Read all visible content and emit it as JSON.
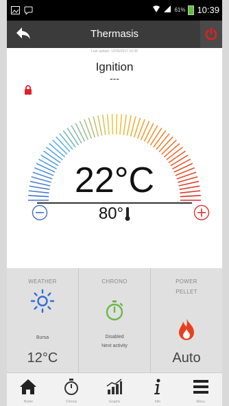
{
  "status_bar": {
    "time": "10:39",
    "battery_percent": "61%",
    "icons": [
      "gallery-icon",
      "chat-icon",
      "wifi-icon",
      "signal-icon",
      "battery-icon"
    ]
  },
  "header": {
    "title": "Thermasis",
    "back_icon": "back-arrow-icon",
    "power_icon": "power-icon",
    "power_color": "#e02020"
  },
  "last_update": "Last update: 12/05/2017 10:39",
  "main": {
    "state_label": "Ignition",
    "state_sub": "---",
    "lock_color": "#e0202a",
    "room_temperature": "22°C",
    "water_temperature": "80°",
    "minus_color": "#3a6fc2",
    "plus_color": "#e03030"
  },
  "cards": {
    "weather": {
      "title": "WEATHER",
      "city": "Bursa",
      "temperature": "12°C",
      "icon": "sun-icon",
      "icon_color": "#2f6bd6"
    },
    "chrono": {
      "title": "CHRONO",
      "status": "Disabled",
      "next": "Next activity",
      "icon": "stopwatch-icon",
      "icon_color": "#6ab84a"
    },
    "power": {
      "title_line1": "POWER",
      "title_line2": "PELLET",
      "mode": "Auto",
      "icon": "flame-icon",
      "icon_color": "#e8401f"
    }
  },
  "nav": {
    "items": [
      {
        "label": "Home",
        "icon": "home-icon"
      },
      {
        "label": "Chrono",
        "icon": "stopwatch-icon"
      },
      {
        "label": "Graphs",
        "icon": "graph-icon"
      },
      {
        "label": "Info",
        "icon": "info-icon"
      },
      {
        "label": "Menu",
        "icon": "menu-icon"
      }
    ]
  }
}
